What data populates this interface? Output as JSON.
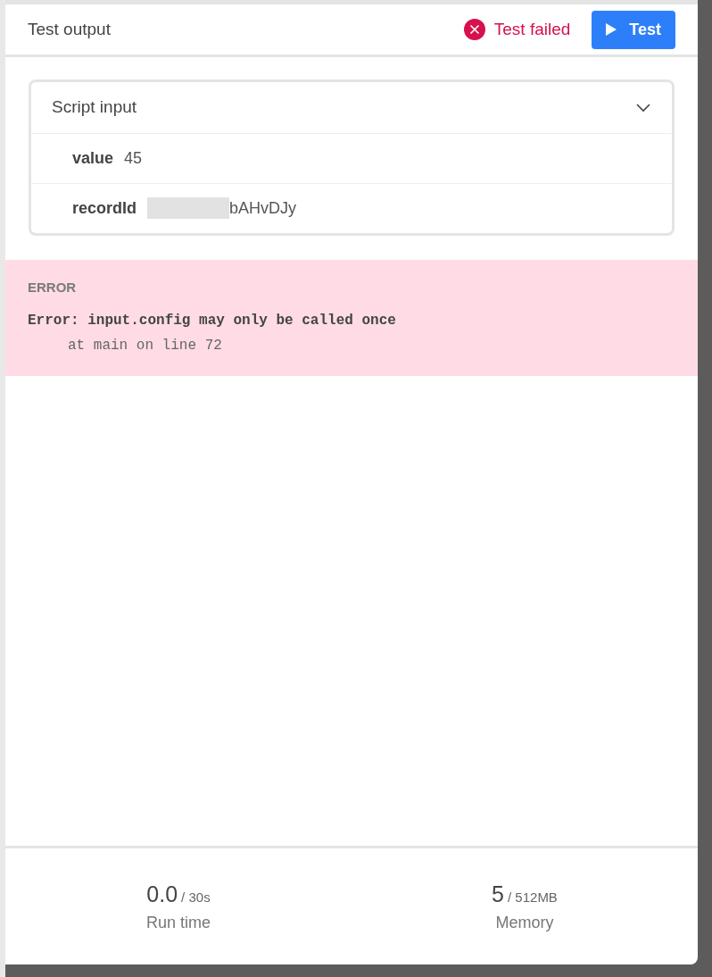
{
  "header": {
    "title": "Test output",
    "status": "Test failed",
    "button": "Test"
  },
  "script_input": {
    "title": "Script input",
    "expanded": true,
    "fields": [
      {
        "name": "value",
        "value": "45",
        "redacted": false
      },
      {
        "name": "recordId",
        "value": "bAHvDJy",
        "redacted": true
      }
    ]
  },
  "error": {
    "label": "ERROR",
    "message": "Error: input.config may only be called once",
    "trace": "at main on line 72"
  },
  "stats": [
    {
      "value": "0.0",
      "limit": "/ 30s",
      "label": "Run time"
    },
    {
      "value": "5",
      "limit": "/ 512MB",
      "label": "Memory"
    }
  ]
}
